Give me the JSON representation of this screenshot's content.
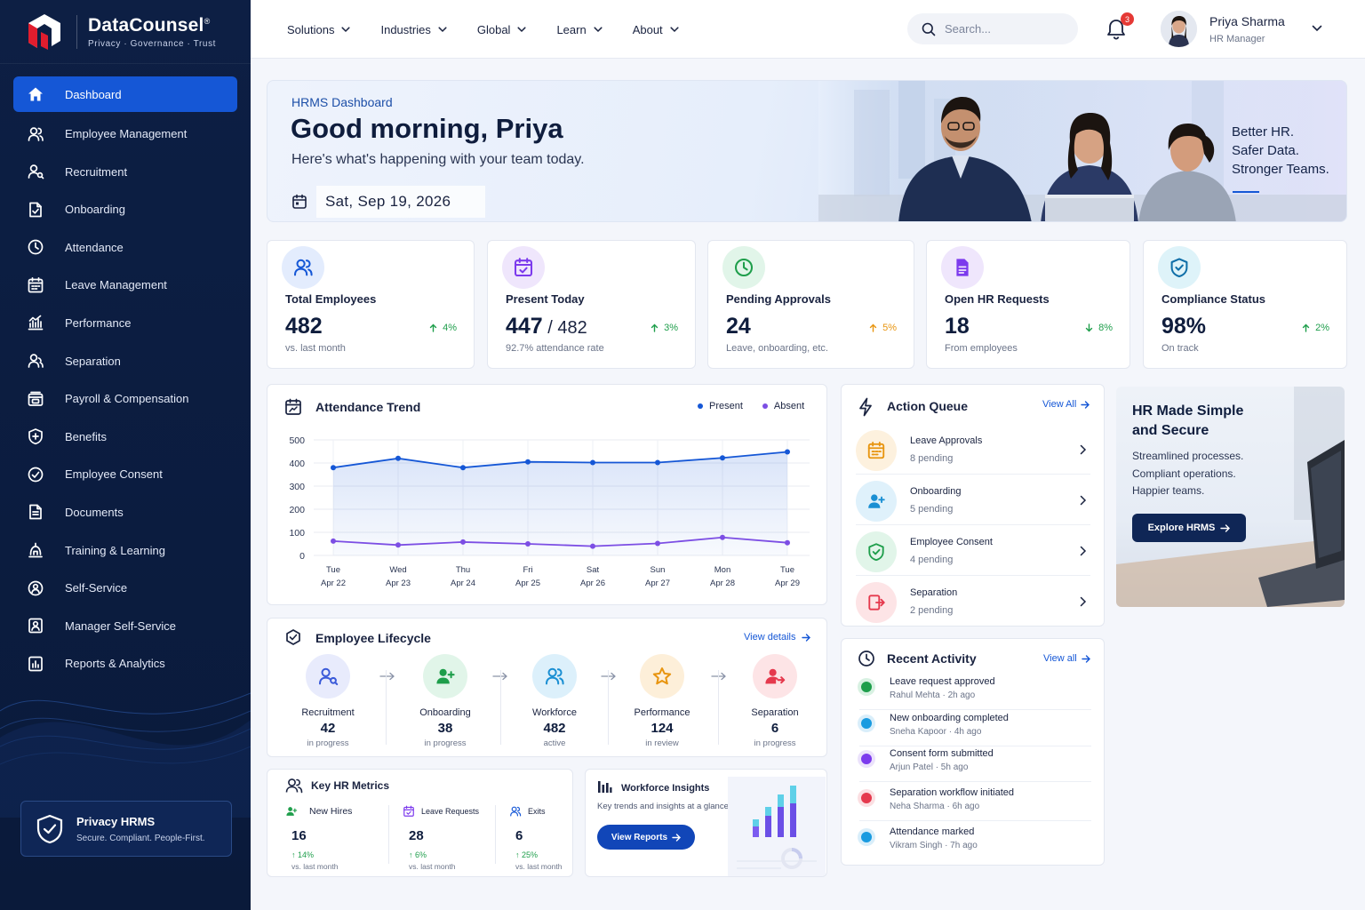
{
  "brand": {
    "name": "DataCounsel",
    "reg": "®",
    "tagline": "Privacy · Governance · Trust"
  },
  "sidebar": {
    "items": [
      {
        "label": "Dashboard",
        "icon": "home-icon",
        "active": true
      },
      {
        "label": "Employee Management",
        "icon": "users-icon"
      },
      {
        "label": "Recruitment",
        "icon": "user-search-icon"
      },
      {
        "label": "Onboarding",
        "icon": "document-check-icon"
      },
      {
        "label": "Attendance",
        "icon": "clock-icon"
      },
      {
        "label": "Leave Management",
        "icon": "calendar-icon"
      },
      {
        "label": "Performance",
        "icon": "chart-icon"
      },
      {
        "label": "Separation",
        "icon": "user-minus-icon"
      },
      {
        "label": "Payroll & Compensation",
        "icon": "wallet-icon"
      },
      {
        "label": "Benefits",
        "icon": "shield-plus-icon"
      },
      {
        "label": "Employee Consent",
        "icon": "consent-icon"
      },
      {
        "label": "Documents",
        "icon": "file-icon"
      },
      {
        "label": "Training & Learning",
        "icon": "training-icon"
      },
      {
        "label": "Self-Service",
        "icon": "self-service-icon"
      },
      {
        "label": "Manager Self-Service",
        "icon": "manager-icon"
      },
      {
        "label": "Reports & Analytics",
        "icon": "report-icon"
      }
    ],
    "privacy_card": {
      "title": "Privacy HRMS",
      "subtitle": "Secure. Compliant. People-First."
    }
  },
  "topbar": {
    "menu": [
      "Solutions",
      "Industries",
      "Global",
      "Learn",
      "About"
    ],
    "search_placeholder": "Search...",
    "notifications": "3",
    "user": {
      "name": "Priya Sharma",
      "role": "HR Manager"
    }
  },
  "hero": {
    "label": "HRMS Dashboard",
    "title": "Good morning, Priya",
    "subtitle": "Here's what's happening with your team today.",
    "date": "Sat, Sep 19, 2026",
    "tagline": [
      "Better HR.",
      "Safer Data.",
      "Stronger Teams."
    ]
  },
  "stats": [
    {
      "title": "Total Employees",
      "value": "482",
      "of": "",
      "sub": "vs. last month",
      "trend": "4%",
      "dir": "up",
      "color": "#1e9e4b",
      "icon": "users-icon",
      "bg": "#e3ecfd",
      "fg": "#1557d6"
    },
    {
      "title": "Present Today",
      "value": "447",
      "of": " / 482",
      "sub": "92.7% attendance rate",
      "trend": "3%",
      "dir": "up",
      "color": "#1e9e4b",
      "icon": "calendar-check-icon",
      "bg": "#efe6fc",
      "fg": "#7c3aed"
    },
    {
      "title": "Pending Approvals",
      "value": "24",
      "of": "",
      "sub": "Leave, onboarding, etc.",
      "trend": "5%",
      "dir": "up",
      "color": "#e89510",
      "icon": "clock-icon",
      "bg": "#e1f5e9",
      "fg": "#1e9e4b"
    },
    {
      "title": "Open HR Requests",
      "value": "18",
      "of": "",
      "sub": "From employees",
      "trend": "8%",
      "dir": "down",
      "color": "#1e9e4b",
      "icon": "document-icon",
      "bg": "#efe6fc",
      "fg": "#7c3aed"
    },
    {
      "title": "Compliance Status",
      "value": "98%",
      "of": "",
      "sub": "On track",
      "trend": "2%",
      "dir": "up",
      "color": "#1e9e4b",
      "icon": "shield-check-icon",
      "bg": "#def3f9",
      "fg": "#0f6fa8"
    }
  ],
  "attendance": {
    "title": "Attendance Trend",
    "legend": [
      {
        "name": "Present",
        "color": "#1557d6"
      },
      {
        "name": "Absent",
        "color": "#7c4ee4"
      }
    ]
  },
  "chart_data": {
    "type": "line",
    "title": "Attendance Trend",
    "categories": [
      [
        "Tue",
        "Apr 22"
      ],
      [
        "Wed",
        "Apr 23"
      ],
      [
        "Thu",
        "Apr 24"
      ],
      [
        "Fri",
        "Apr 25"
      ],
      [
        "Sat",
        "Apr 26"
      ],
      [
        "Sun",
        "Apr 27"
      ],
      [
        "Mon",
        "Apr 28"
      ],
      [
        "Tue",
        "Apr 29"
      ]
    ],
    "series": [
      {
        "name": "Present",
        "values": [
          380,
          420,
          380,
          405,
          402,
          402,
          422,
          448
        ],
        "color": "#1557d6"
      },
      {
        "name": "Absent",
        "values": [
          62,
          45,
          58,
          50,
          40,
          52,
          78,
          55
        ],
        "color": "#7c4ee4"
      }
    ],
    "ylim": [
      0,
      500
    ],
    "yticks": [
      0,
      100,
      200,
      300,
      400,
      500
    ],
    "grid": true,
    "legend": "top-right"
  },
  "action_queue": {
    "title": "Action Queue",
    "view_all": "View All",
    "items": [
      {
        "name": "Leave Approvals",
        "pending": "8 pending",
        "icon": "calendar-icon",
        "bg": "#fdf1de",
        "fg": "#e89510"
      },
      {
        "name": "Onboarding",
        "pending": "5 pending",
        "icon": "user-plus-icon",
        "bg": "#dff1fb",
        "fg": "#1a8fd3"
      },
      {
        "name": "Employee Consent",
        "pending": "4 pending",
        "icon": "shield-check-icon",
        "bg": "#e1f5e9",
        "fg": "#1e9e4b"
      },
      {
        "name": "Separation",
        "pending": "2 pending",
        "icon": "exit-icon",
        "bg": "#fde4e6",
        "fg": "#e5394d"
      }
    ]
  },
  "promo": {
    "title": "HR Made Simple and Secure",
    "title_lines": [
      "HR Made Simple",
      "and Secure"
    ],
    "lines": [
      "Streamlined processes.",
      "Compliant operations.",
      "Happier teams."
    ],
    "button": "Explore HRMS"
  },
  "lifecycle": {
    "title": "Employee Lifecycle",
    "view": "View details",
    "stages": [
      {
        "name": "Recruitment",
        "value": "42",
        "sub": "in progress",
        "icon": "user-search-icon",
        "bg": "#e8ebfc",
        "fg": "#3b5bd9"
      },
      {
        "name": "Onboarding",
        "value": "38",
        "sub": "in progress",
        "icon": "user-plus-icon",
        "bg": "#e1f5e9",
        "fg": "#1e9e4b"
      },
      {
        "name": "Workforce",
        "value": "482",
        "sub": "active",
        "icon": "users-icon",
        "bg": "#dcf0fb",
        "fg": "#1a8fd3"
      },
      {
        "name": "Performance",
        "value": "124",
        "sub": "in review",
        "icon": "star-icon",
        "bg": "#fdefd9",
        "fg": "#e89510"
      },
      {
        "name": "Separation",
        "value": "6",
        "sub": "in progress",
        "icon": "user-exit-icon",
        "bg": "#fde4e6",
        "fg": "#e5394d"
      }
    ]
  },
  "recent": {
    "title": "Recent Activity",
    "view_all": "View all",
    "items": [
      {
        "title": "Leave request approved",
        "meta": "Rahul Mehta · 2h ago",
        "color": "#1e9e4b",
        "ring": "#d8f1e2"
      },
      {
        "title": "New onboarding completed",
        "meta": "Sneha Kapoor · 4h ago",
        "color": "#1a9be0",
        "ring": "#d9eefa"
      },
      {
        "title": "Consent form submitted",
        "meta": "Arjun Patel · 5h ago",
        "color": "#7c3aed",
        "ring": "#ebe2fb"
      },
      {
        "title": "Separation workflow initiated",
        "meta": "Neha Sharma · 6h ago",
        "color": "#e5394d",
        "ring": "#fbdfe2"
      },
      {
        "title": "Attendance marked",
        "meta": "Vikram Singh · 7h ago",
        "color": "#1a9be0",
        "ring": "#d9eefa"
      }
    ]
  },
  "metrics": {
    "title": "Key HR Metrics",
    "items": [
      {
        "label": "New Hires",
        "value": "16",
        "trend": "14%",
        "sub": "vs. last month",
        "color": "#1e9e4b"
      },
      {
        "label": "Leave Requests",
        "value": "28",
        "trend": "6%",
        "sub": "vs. last month",
        "color": "#7c3aed"
      },
      {
        "label": "Exits",
        "value": "6",
        "trend": "25%",
        "sub": "vs. last month",
        "color": "#1557d6"
      }
    ]
  },
  "insights": {
    "title": "Workforce Insights",
    "subtitle": "Key trends and insights at a glance.",
    "button": "View Reports"
  }
}
